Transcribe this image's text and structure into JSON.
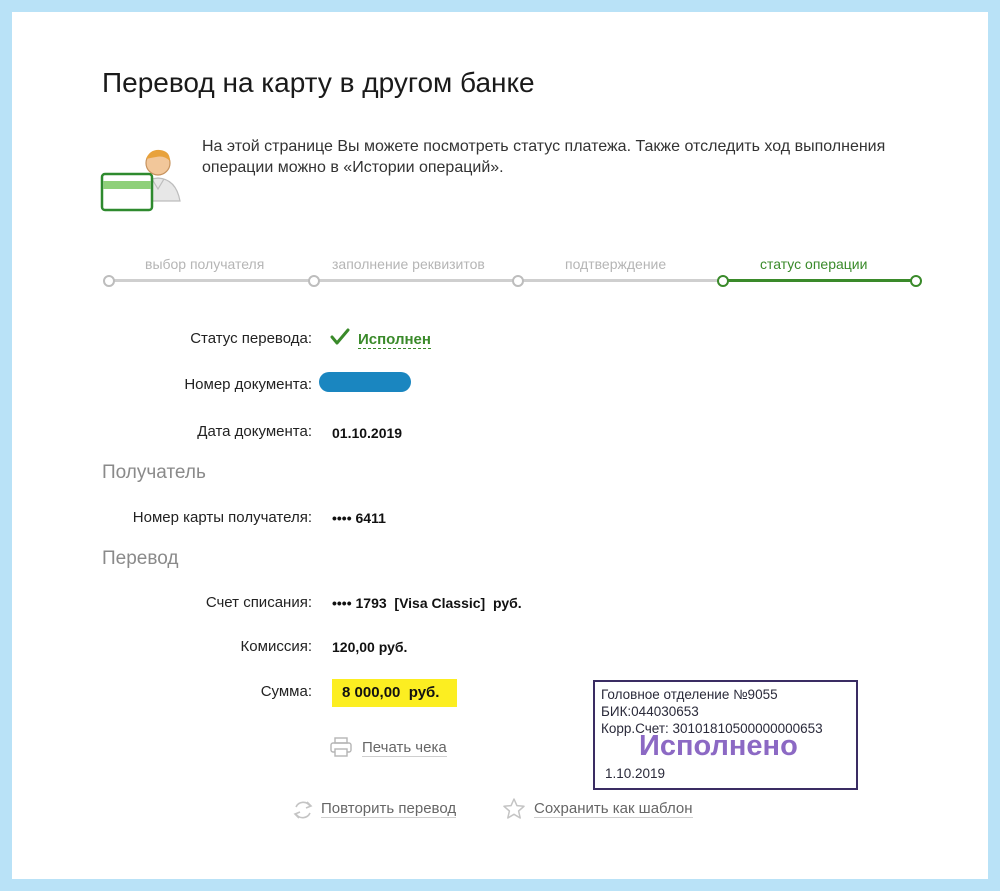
{
  "page": {
    "title": "Перевод на карту в другом банке",
    "intro": "На этой странице Вы можете посмотреть статус платежа. Также отследить ход выполнения операции можно в «Истории операций»."
  },
  "steps": [
    {
      "label": "выбор получателя"
    },
    {
      "label": "заполнение реквизитов"
    },
    {
      "label": "подтверждение"
    },
    {
      "label": "статус операции",
      "active": true
    }
  ],
  "colors": {
    "accent": "#3a8a2a",
    "highlight": "#fcee21",
    "redaction": "#1a86c0",
    "stamp_border": "#3a2c63",
    "stamp_text": "#8c69c4"
  },
  "status": {
    "label": "Статус перевода:",
    "value": "Исполнен"
  },
  "document_number": {
    "label": "Номер документа:"
  },
  "document_date": {
    "label": "Дата документа:",
    "value": "01.10.2019"
  },
  "recipient": {
    "heading": "Получатель",
    "card_label": "Номер карты получателя:",
    "card_value": "•••• 6411"
  },
  "transfer": {
    "heading": "Перевод",
    "account_label": "Счет списания:",
    "account_value": "•••• 1793  [Visa Classic]  руб.",
    "fee_label": "Комиссия:",
    "fee_value": "120,00 руб.",
    "amount_label": "Сумма:",
    "amount_value": "8 000,00  руб."
  },
  "actions": {
    "print": "Печать чека",
    "repeat": "Повторить перевод",
    "save_template": "Сохранить как шаблон"
  },
  "stamp": {
    "line1": "Головное отделение №9055",
    "line2": "БИК:044030653",
    "line3": "Корр.Счет: 30101810500000000653",
    "big": "Исполнено",
    "date": "1.10.2019"
  }
}
